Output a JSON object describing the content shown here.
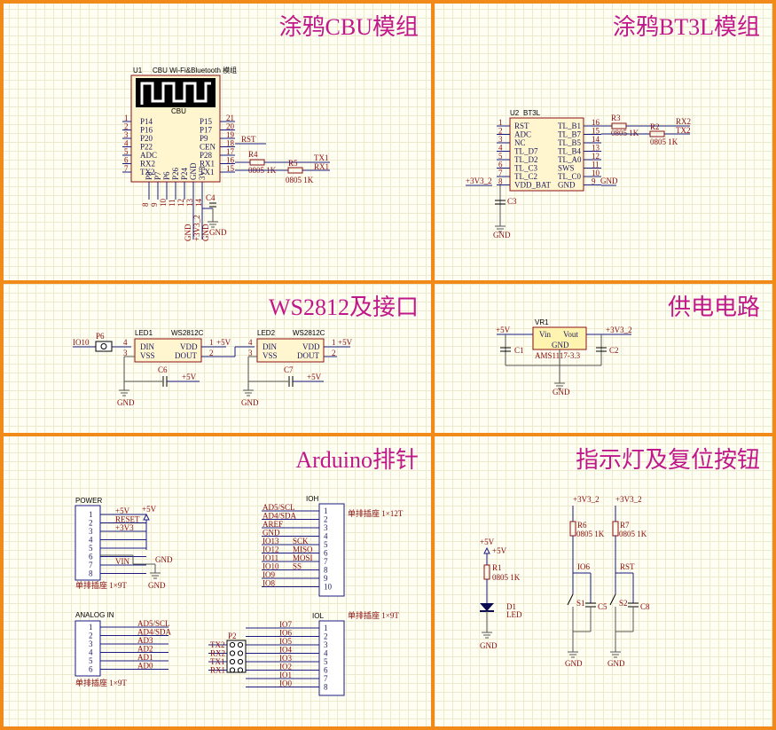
{
  "panels": {
    "cbu_title": "涂鸦CBU模组",
    "bt3l_title": "涂鸦BT3L模组",
    "ws_title": "WS2812及接口",
    "power_title": "供电电路",
    "arduino_title": "Arduino排针",
    "led_title": "指示灯及复位按钮"
  },
  "cbu": {
    "ref": "U1",
    "desc": "CBU Wi-Fi&Bluetooth 模组",
    "chip_label": "CBU",
    "left_pins": [
      "P14",
      "P16",
      "P20",
      "P22",
      "ADC",
      "RX2",
      "TX2"
    ],
    "left_nums": [
      "1",
      "2",
      "3",
      "4",
      "5",
      "6",
      "7"
    ],
    "right_pins": [
      "P15",
      "P17",
      "P9",
      "CEN",
      "P28",
      "RX1",
      "TX1"
    ],
    "right_nums": [
      "21",
      "20",
      "19",
      "18",
      "17",
      "16",
      "15"
    ],
    "bottom_pins": [
      "P8",
      "P7",
      "P6",
      "P26",
      "P24",
      "GND",
      "3V3"
    ],
    "bottom_nums": [
      "8",
      "9",
      "10",
      "11",
      "12",
      "13",
      "14"
    ],
    "net_rst": "RST",
    "net_tx1": "TX1",
    "net_rx1": "RX1",
    "r4": "R4",
    "r4_val": "0805 1K",
    "r5": "R5",
    "r5_val": "0805 1K",
    "c4": "C4",
    "gnd1": "GND",
    "gnd2": "GND",
    "v33": "+3V3_2",
    "gnd3": "GND"
  },
  "bt3l": {
    "ref": "U2",
    "name": "BT3L",
    "left_pins": [
      "RST",
      "ADC",
      "NC",
      "TL_D7",
      "TL_D2",
      "TL_C3",
      "TL_C2",
      "VDD_BAT"
    ],
    "left_nums": [
      "1",
      "2",
      "3",
      "4",
      "5",
      "6",
      "7",
      "8"
    ],
    "right_pins": [
      "TL_B1",
      "TL_B7",
      "TL_B5",
      "TL_B4",
      "TL_A0",
      "SWS",
      "TL_C0",
      "GND"
    ],
    "right_nums": [
      "16",
      "15",
      "14",
      "13",
      "12",
      "11",
      "10",
      "9"
    ],
    "r3": "R3",
    "r3_val": "0805 1K",
    "r2": "R2",
    "r2_val": "0805 1K",
    "net_rx2": "RX2",
    "net_tx2": "TX2",
    "gnd_pin": "GND",
    "v33": "+3V3_2",
    "c3": "C3",
    "gnd": "GND"
  },
  "ws": {
    "io10": "IO10",
    "p6": "P6",
    "led1": "LED1",
    "led2": "LED2",
    "part": "WS2812C",
    "din": "DIN",
    "vss": "VSS",
    "vdd": "VDD",
    "dout": "DOUT",
    "n4": "4",
    "n3": "3",
    "n1": "1",
    "n2": "2",
    "v5": "+5V",
    "c6": "C6",
    "c7": "C7",
    "gnd": "GND"
  },
  "power": {
    "vr": "VR1",
    "vin": "Vin",
    "vout": "Vout",
    "gnd_pin": "GND",
    "part": "AMS1117-3.3",
    "v5": "+5V",
    "v33": "+3V3_2",
    "c1": "C1",
    "c2": "C2",
    "gnd": "GND"
  },
  "arduino": {
    "power_name": "POWER",
    "power_nets": [
      "+5V",
      "RESET",
      "+3V3",
      "",
      "",
      "",
      "VIN",
      ""
    ],
    "power_nums": [
      "1",
      "2",
      "3",
      "4",
      "5",
      "6",
      "7",
      "8"
    ],
    "power_type": "单排插座 1×9T",
    "v5": "+5V",
    "gnd": "GND",
    "gnd2": "GND",
    "ioh_name": "IOH",
    "ioh_nets": [
      "AD5/SCL",
      "AD4/SDA",
      "AREF",
      "GND",
      "IO13",
      "IO12",
      "IO11",
      "IO10",
      "IO9",
      "IO8"
    ],
    "ioh_sig": [
      "",
      "",
      "",
      "",
      "SCK",
      "MISO",
      "MOSI",
      "SS",
      "",
      ""
    ],
    "ioh_nums": [
      "1",
      "2",
      "3",
      "4",
      "5",
      "6",
      "7",
      "8",
      "9",
      "10"
    ],
    "ioh_type": "单排插座 1×12T",
    "analog_name": "ANALOG IN",
    "analog_nets": [
      "AD5/SCL",
      "AD4/SDA",
      "AD3",
      "AD2",
      "AD1",
      "AD0"
    ],
    "analog_nums": [
      "1",
      "2",
      "3",
      "4",
      "5",
      "6"
    ],
    "analog_type": "单排插座 1×9T",
    "iol_name": "IOL",
    "iol_nets": [
      "IO7",
      "IO6",
      "IO5",
      "IO4",
      "IO3",
      "IO2",
      "IO1",
      "IO0"
    ],
    "iol_nums": [
      "1",
      "2",
      "3",
      "4",
      "5",
      "6",
      "7",
      "8"
    ],
    "iol_type": "单排插座 1×9T",
    "p2": "P2",
    "p2_nets": [
      "TX2",
      "RX2",
      "TX1",
      "RX1"
    ]
  },
  "led": {
    "v5": "+5V",
    "r1": "R1",
    "r1_val": "0805 1K",
    "d1": "D1",
    "d1_name": "LED",
    "gnd": "GND",
    "v33a": "+3V3_2",
    "v33b": "+3V3_2",
    "r6": "R6",
    "r6_val": "0805 1K",
    "r7": "R7",
    "r7_val": "0805 1K",
    "io6": "IO6",
    "rst": "RST",
    "s1": "S1",
    "s2": "S2",
    "c5": "C5",
    "c8": "C8",
    "gnd1": "GND",
    "gnd2": "GND"
  },
  "colors": {
    "border": "#f28a1a",
    "title": "#c0188a",
    "wire": "#1a1a80",
    "net": "#8a0a0a"
  }
}
